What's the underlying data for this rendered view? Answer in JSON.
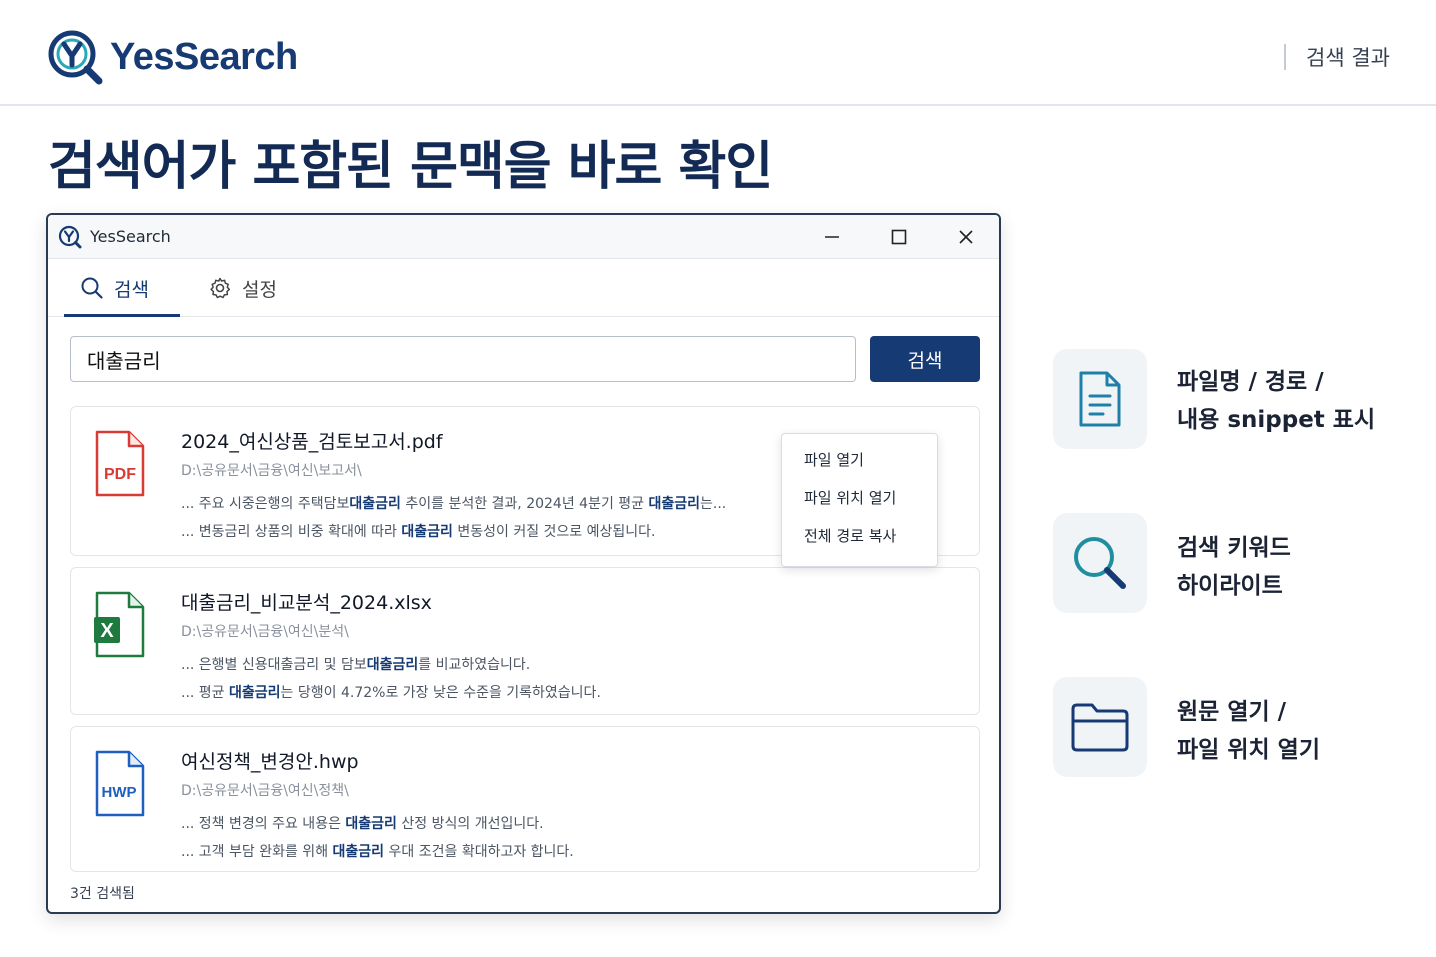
{
  "header": {
    "brand": "YesSearch",
    "right_label": "검색 결과"
  },
  "headline": "검색어가 포함된 문맥을 바로 확인",
  "window": {
    "title": "YesSearch",
    "tabs": [
      {
        "label": "검색",
        "icon": "search-icon",
        "active": true
      },
      {
        "label": "설정",
        "icon": "gear-icon",
        "active": false
      }
    ],
    "search": {
      "value": "대출금리",
      "button": "검색"
    },
    "results": [
      {
        "type": "PDF",
        "filename": "2024_여신상품_검토보고서.pdf",
        "path": "D:\\공유문서\\금융\\여신\\보고서\\",
        "snippet1": {
          "pre": "... 주요 시중은행의 주택담보",
          "hl": "대출금리",
          "mid": " 추이를 분석한 결과, 2024년 4분기 평균 ",
          "hl2": "대출금리",
          "post": "는..."
        },
        "snippet2": {
          "pre": "... 변동금리 상품의 비중 확대에 따라 ",
          "hl": "대출금리",
          "post": " 변동성이 커질 것으로 예상됩니다."
        }
      },
      {
        "type": "X",
        "filename": "대출금리_비교분석_2024.xlsx",
        "path": "D:\\공유문서\\금융\\여신\\분석\\",
        "snippet1": {
          "pre": "... 은행별 신용대출금리 및 담보",
          "hl": "대출금리",
          "post": "를 비교하였습니다."
        },
        "snippet2": {
          "pre": "... 평균 ",
          "hl": "대출금리",
          "post": "는 당행이 4.72%로 가장 낮은 수준을 기록하였습니다."
        }
      },
      {
        "type": "HWP",
        "filename": "여신정책_변경안.hwp",
        "path": "D:\\공유문서\\금융\\여신\\정책\\",
        "snippet1": {
          "pre": "... 정책 변경의 주요 내용은 ",
          "hl": "대출금리",
          "post": " 산정 방식의 개선입니다."
        },
        "snippet2": {
          "pre": "... 고객 부담 완화를 위해 ",
          "hl": "대출금리",
          "post": " 우대 조건을 확대하고자 합니다."
        }
      }
    ],
    "context_menu": [
      "파일 열기",
      "파일 위치 열기",
      "전체 경로 복사"
    ],
    "status": "3건 검색됨"
  },
  "features": [
    {
      "icon": "document-icon",
      "line1": "파일명 / 경로 /",
      "line2": "내용 snippet 표시"
    },
    {
      "icon": "search-icon",
      "line1": "검색 키워드",
      "line2": "하이라이트"
    },
    {
      "icon": "folder-icon",
      "line1": "원문 열기 /",
      "line2": "파일 위치 열기"
    }
  ],
  "colors": {
    "brand_navy": "#163a73",
    "highlight": "#163a73",
    "pdf_red": "#d93a34",
    "excel_green": "#1e7a3e",
    "hwp_blue": "#1f5fbf",
    "icon_teal": "#1f8fa0"
  }
}
